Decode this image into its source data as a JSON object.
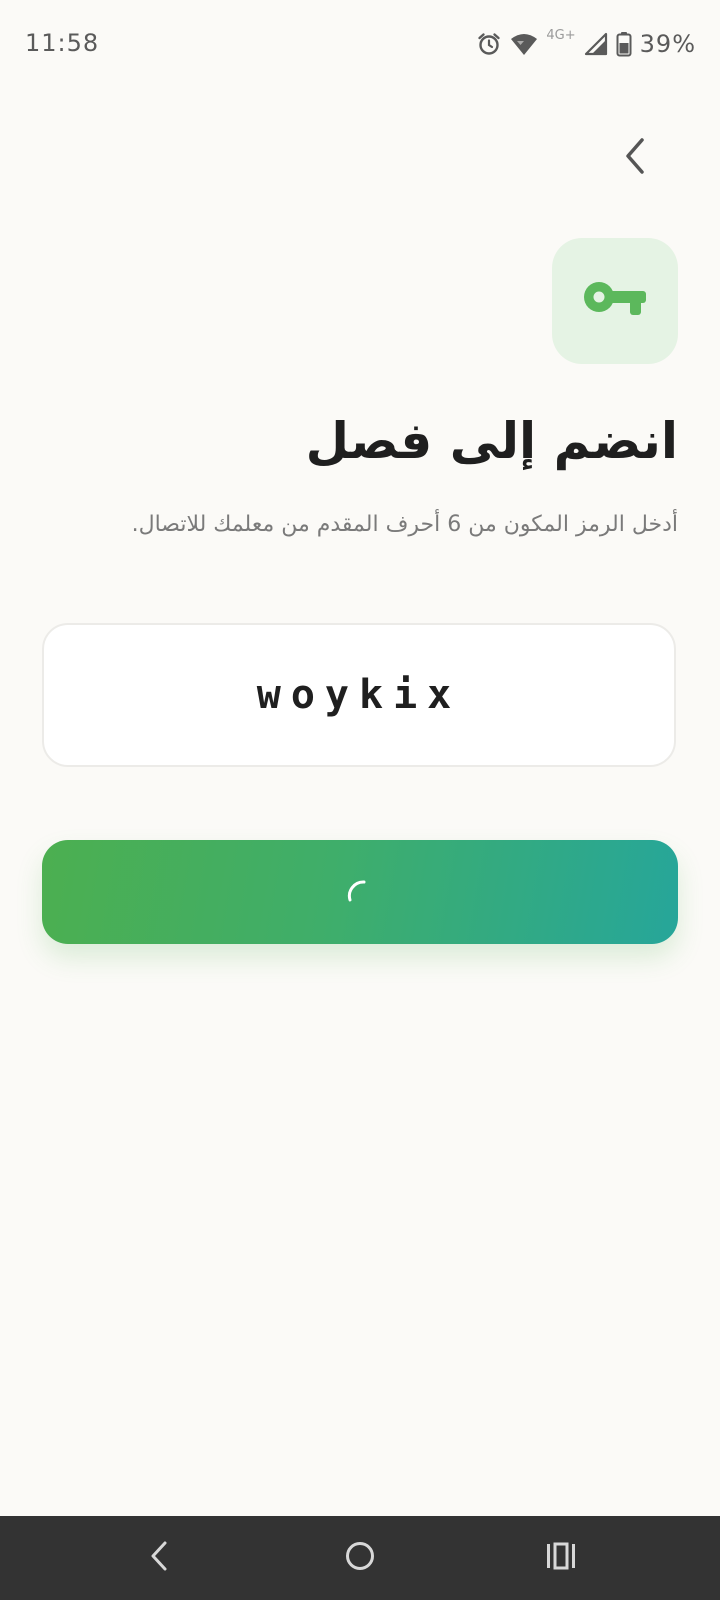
{
  "status_bar": {
    "time": "11:58",
    "network_label": "4G+",
    "battery_percent": "39%",
    "icons": [
      "alarm-icon",
      "wifi-icon",
      "signal-icon",
      "battery-icon"
    ]
  },
  "header": {
    "back_icon": "chevron-back-icon"
  },
  "hero": {
    "icon": "key-icon",
    "tile_color": "#e5f3e4",
    "icon_color": "#5cb85c"
  },
  "page": {
    "title": "انضم إلى فصل",
    "subtitle": "أدخل الرمز المكون من 6 أحرف المقدم من معلمك للاتصال."
  },
  "code_input": {
    "value": "woykix"
  },
  "join_button": {
    "state": "loading",
    "gradient_start": "#4caf50",
    "gradient_end": "#26a69a"
  },
  "nav_bar": {
    "back_icon": "nav-back-icon",
    "home_icon": "nav-home-icon",
    "recents_icon": "nav-recents-icon"
  }
}
